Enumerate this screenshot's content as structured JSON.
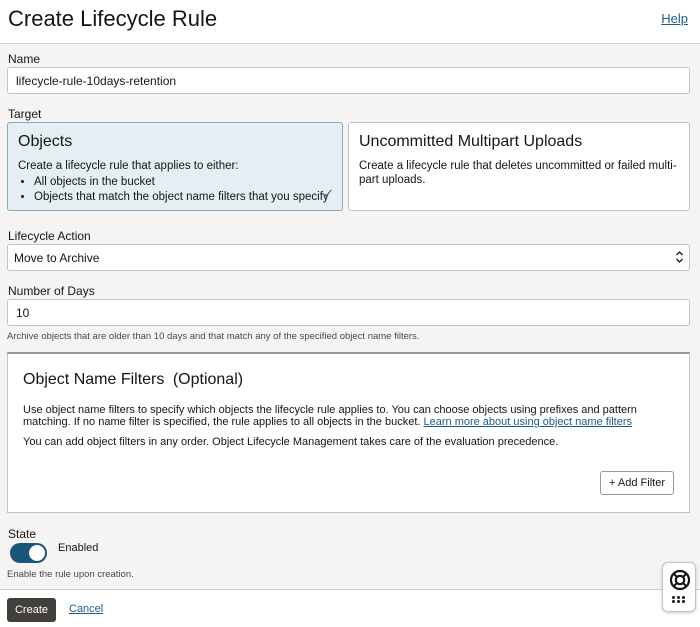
{
  "header": {
    "title": "Create Lifecycle Rule",
    "help_label": "Help"
  },
  "name": {
    "label": "Name",
    "value": "lifecycle-rule-10days-retention"
  },
  "target": {
    "label": "Target",
    "options": [
      {
        "title": "Objects",
        "description": "Create a lifecycle rule that applies to either:",
        "bullets": [
          "All objects in the bucket",
          "Objects that match the object name filters that you specify"
        ],
        "selected": true
      },
      {
        "title": "Uncommitted Multipart Uploads",
        "description": "Create a lifecycle rule that deletes uncommitted or failed multi-part uploads.",
        "selected": false
      }
    ]
  },
  "lifecycle_action": {
    "label": "Lifecycle Action",
    "value": "Move to Archive"
  },
  "days": {
    "label": "Number of Days",
    "value": "10",
    "helper": "Archive objects that are older than 10 days and that match any of the specified object name filters."
  },
  "filters": {
    "title": "Object Name Filters",
    "optional": "(Optional)",
    "text1": "Use object name filters to specify which objects the lifecycle rule applies to. You can choose objects using prefixes and pattern matching. If no name filter is specified, the rule applies to all objects in the bucket.",
    "link": "Learn more about using object name filters",
    "text2": "You can add object filters in any order. Object Lifecycle Management takes care of the evaluation precedence.",
    "add_label": "+ Add Filter"
  },
  "state": {
    "label": "State",
    "toggle_label": "Enabled",
    "enabled": true,
    "helper": "Enable the rule upon creation."
  },
  "footer": {
    "create_label": "Create",
    "cancel_label": "Cancel"
  },
  "colors": {
    "accent": "#1a5578",
    "link": "#1a5c8e",
    "primary_button": "#433f3a",
    "selected_card": "#e4eef3"
  },
  "icons": {
    "check": "check-icon",
    "selector": "updown-chevron-icon",
    "help_widget": "lifebuoy-icon",
    "apps": "grid-dots-icon"
  }
}
